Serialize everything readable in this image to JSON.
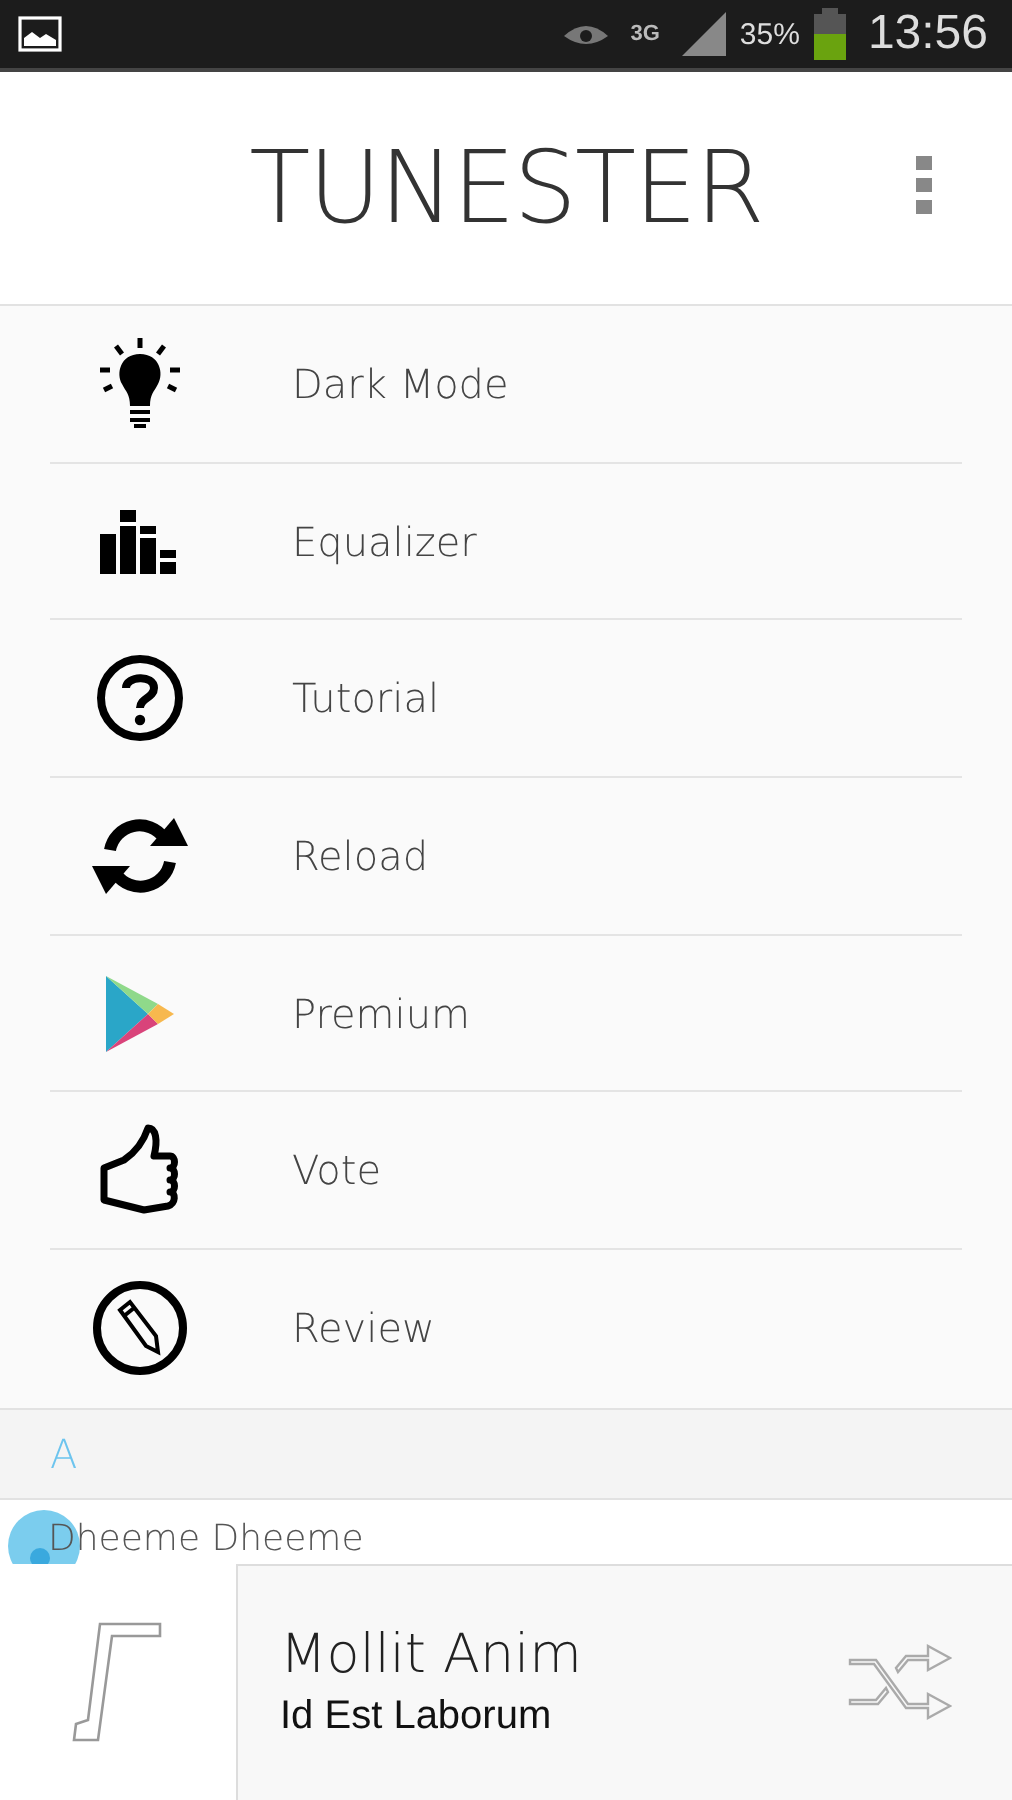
{
  "status_bar": {
    "battery": "35%",
    "time": "13:56",
    "network": "3G"
  },
  "app_bar": {
    "title": "TUNESTER"
  },
  "menu": [
    {
      "label": "Dark Mode",
      "kind": "bulb"
    },
    {
      "label": "Equalizer",
      "kind": "equalizer"
    },
    {
      "label": "Tutorial",
      "kind": "help"
    },
    {
      "label": "Reload",
      "kind": "reload"
    },
    {
      "label": "Premium",
      "kind": "play"
    },
    {
      "label": "Vote",
      "kind": "thumb"
    },
    {
      "label": "Review",
      "kind": "pencil"
    }
  ],
  "section": {
    "letter": "A"
  },
  "songs": [
    {
      "title": "Dheeme Dheeme"
    }
  ],
  "player": {
    "title": "Mollit Anim",
    "artist": "Id Est Laborum"
  }
}
